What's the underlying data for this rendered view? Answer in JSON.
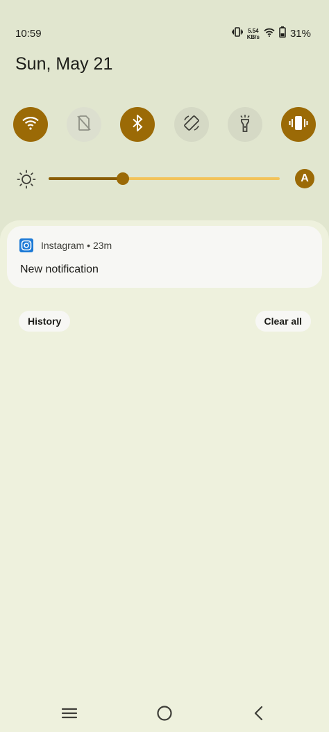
{
  "status_bar": {
    "time": "10:59",
    "net_speed_value": "5.54",
    "net_speed_unit": "KB/s",
    "battery_percent": "31%",
    "icons": [
      "vibrate-icon",
      "wifi-icon",
      "battery-icon"
    ]
  },
  "date": "Sun, May 21",
  "quick_tiles": [
    {
      "name": "wifi",
      "icon": "wifi-icon",
      "state": "on"
    },
    {
      "name": "mobile-data",
      "icon": "no-sim-icon",
      "state": "off"
    },
    {
      "name": "bluetooth",
      "icon": "bluetooth-icon",
      "state": "on"
    },
    {
      "name": "auto-rotate",
      "icon": "rotate-icon",
      "state": "off"
    },
    {
      "name": "flashlight",
      "icon": "flashlight-icon",
      "state": "off"
    },
    {
      "name": "vibrate",
      "icon": "vibrate-icon",
      "state": "on"
    }
  ],
  "brightness": {
    "level": 0.32,
    "auto_label": "A"
  },
  "notification": {
    "app_name": "Instagram",
    "separator": "•",
    "time": "23m",
    "text": "New notification"
  },
  "actions": {
    "history": "History",
    "clear_all": "Clear all"
  },
  "colors": {
    "accent": "#9b6a06",
    "accent_light": "#f2c35a",
    "shade_bg": "#e1e6cf",
    "panel_bg": "#eef1dd",
    "card_bg": "#f7f7f4"
  }
}
